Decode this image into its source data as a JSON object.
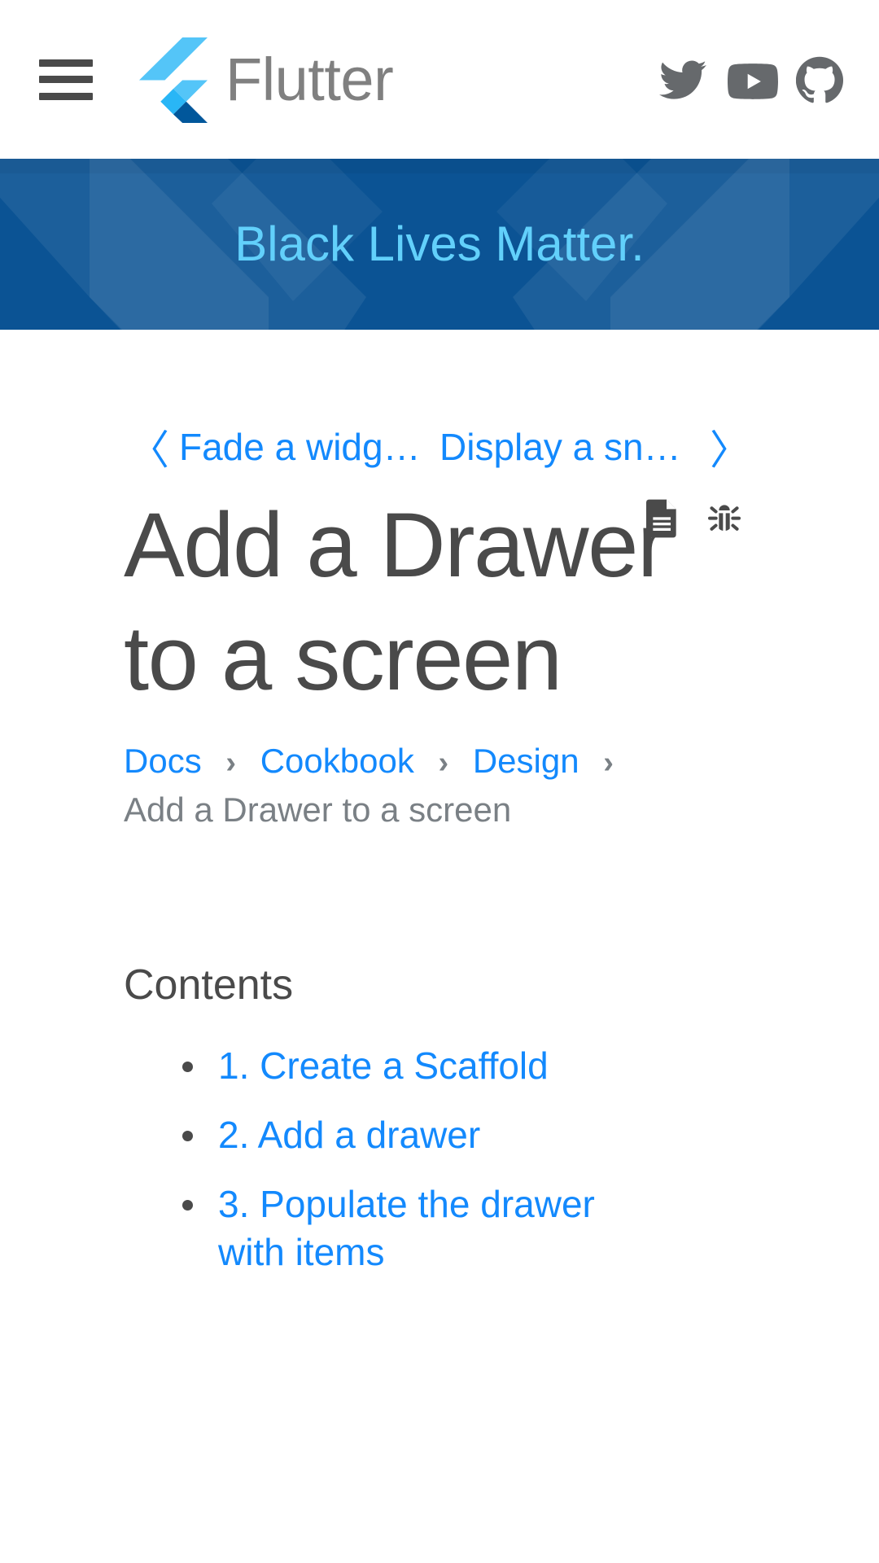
{
  "header": {
    "menu_label": "Menu",
    "brand_name": "Flutter",
    "social": [
      {
        "name": "twitter",
        "label": "Twitter"
      },
      {
        "name": "youtube",
        "label": "YouTube"
      },
      {
        "name": "github",
        "label": "GitHub"
      }
    ]
  },
  "banner": {
    "text": "Black Lives Matter.",
    "background_color": "#0b5394",
    "text_color": "#62d0fb"
  },
  "page_nav": {
    "prev_chevron": "〈",
    "prev_label": "Fade a widge…",
    "next_label": "Display a sna…",
    "next_chevron": "〉"
  },
  "title": {
    "text": "Add a Drawer to a screen",
    "icons": [
      {
        "name": "page-source",
        "label": "View source"
      },
      {
        "name": "bug-report",
        "label": "Report an issue"
      }
    ]
  },
  "breadcrumb": {
    "items": [
      {
        "label": "Docs",
        "link": true
      },
      {
        "label": "Cookbook",
        "link": true
      },
      {
        "label": "Design",
        "link": true
      },
      {
        "label": "Add a Drawer to a screen",
        "link": false
      }
    ],
    "separator": "›"
  },
  "contents": {
    "heading": "Contents",
    "items": [
      "1. Create a Scaffold",
      "2. Add a drawer",
      "3. Populate the drawer with items"
    ]
  },
  "colors": {
    "link": "#1389fd",
    "text": "#4a4a4a",
    "muted": "#7a8085",
    "brand_gray": "#808080",
    "flutter_light": "#54c5f8",
    "flutter_mid": "#29b6f6",
    "flutter_dark": "#01579b"
  }
}
